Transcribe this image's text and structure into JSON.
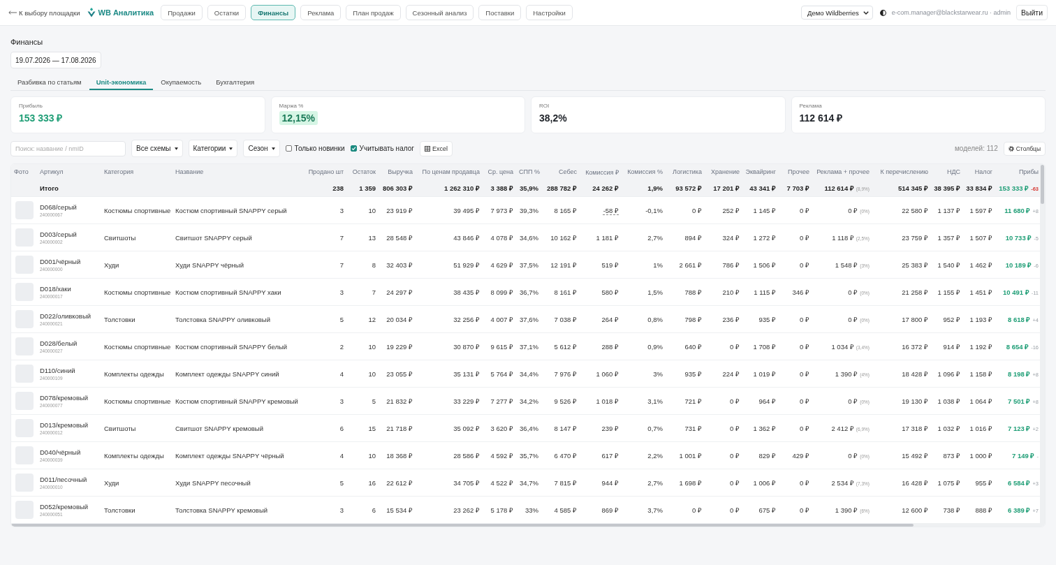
{
  "nav": {
    "back_link": "К выбору площадки",
    "brand": "WB Аналитика",
    "items": [
      {
        "label": "Продажи",
        "selected": false
      },
      {
        "label": "Остатки",
        "selected": false
      },
      {
        "label": "Финансы",
        "selected": true
      },
      {
        "label": "Реклама",
        "selected": false
      },
      {
        "label": "План продаж",
        "selected": false
      },
      {
        "label": "Сезонный анализ",
        "selected": false
      },
      {
        "label": "Поставки",
        "selected": false
      },
      {
        "label": "Настройки",
        "selected": false
      }
    ],
    "store_select": "Демо Wildberries",
    "user": "e-com.manager@blackstarwear.ru · admin",
    "logout": "Выйти"
  },
  "page": {
    "title": "Финансы",
    "date_range": "19.07.2026 — 17.08.2026",
    "tabs": [
      {
        "label": "Разбивка по статьям",
        "selected": false
      },
      {
        "label": "Unit-экономика",
        "selected": true
      },
      {
        "label": "Окупаемость",
        "selected": false
      },
      {
        "label": "Бухгалтерия",
        "selected": false
      }
    ]
  },
  "kpis": [
    {
      "label": "Прибыль",
      "value": "153 333 ₽",
      "kind": "accent"
    },
    {
      "label": "Маржа %",
      "value": "12,15%",
      "kind": "badge"
    },
    {
      "label": "ROI",
      "value": "38,2%",
      "kind": "plain"
    },
    {
      "label": "Реклама",
      "value": "112 614 ₽",
      "kind": "plain"
    }
  ],
  "filters": {
    "search": {
      "placeholder": "Поиск: название / nmID"
    },
    "dropdowns": [
      "Все схемы",
      "Категории",
      "Сезон"
    ],
    "checkboxes": [
      {
        "label": "Только новинки",
        "checked": false
      },
      {
        "label": "Учитывать налог",
        "checked": true
      }
    ],
    "export": "Excel",
    "count": "моделей: 112",
    "columns_button": "Столбцы"
  },
  "table": {
    "columns": [
      "Фото",
      "Артикул",
      "Категория",
      "Название",
      "Продано шт",
      "Остаток",
      "Выручка",
      "По ценам продавца",
      "Ср. цена",
      "СПП %",
      "Себес",
      "Комиссия ₽",
      "Комиссия %",
      "Логистика",
      "Хранение",
      "Эквайринг",
      "Прочее",
      "Реклама + прочее",
      "К перечислению",
      "НДС",
      "Налог",
      "Прибы"
    ],
    "total": {
      "cells": [
        "",
        "Итого",
        "",
        "",
        "238",
        "1 359",
        "806 303 ₽",
        "1 262 310 ₽",
        "3 388 ₽",
        "35,9%",
        "288 782 ₽",
        "24 262 ₽",
        "1,9%",
        "93 572 ₽",
        "17 201 ₽",
        "43 341 ₽",
        "7 703 ₽",
        {
          "kind": "share",
          "text": "112 614 ₽",
          "share": "(8,9%)"
        },
        "514 345 ₽",
        "38 395 ₽",
        "33 834 ₽",
        {
          "kind": "profit",
          "text": "153 333 ₽",
          "delta": "-63",
          "negative": true
        }
      ]
    },
    "rows": [
      {
        "cells": [
          {
            "kind": "photo"
          },
          {
            "kind": "article",
            "text": "D068/серый",
            "nmid": "240000067"
          },
          "Костюмы спортивные",
          "Костюм спортивный SNAPPY серый",
          "3",
          "10",
          "23 919 ₽",
          "39 495 ₽",
          "7 973 ₽",
          "39,3%",
          "8 165 ₽",
          {
            "kind": "flagged",
            "text": "-58 ₽"
          },
          "-0,1%",
          "0 ₽",
          "252 ₽",
          "1 145 ₽",
          "0 ₽",
          {
            "kind": "share",
            "text": "0 ₽",
            "share": "(0%)"
          },
          "22 580 ₽",
          "1 137 ₽",
          "1 597 ₽",
          {
            "kind": "profit",
            "text": "11 680 ₽",
            "delta": "+8",
            "negative": false
          }
        ]
      },
      {
        "cells": [
          {
            "kind": "photo"
          },
          {
            "kind": "article",
            "text": "D003/серый",
            "nmid": "240000002"
          },
          "Свитшоты",
          "Свитшот SNAPPY серый",
          "7",
          "13",
          "28 548 ₽",
          "43 846 ₽",
          "4 078 ₽",
          "34,6%",
          "10 162 ₽",
          "1 181 ₽",
          "2,7%",
          "894 ₽",
          "324 ₽",
          "1 272 ₽",
          "0 ₽",
          {
            "kind": "share",
            "text": "1 118 ₽",
            "share": "(2,5%)"
          },
          "23 759 ₽",
          "1 357 ₽",
          "1 507 ₽",
          {
            "kind": "profit",
            "text": "10 733 ₽",
            "delta": "-5",
            "negative": false
          }
        ]
      },
      {
        "cells": [
          {
            "kind": "photo"
          },
          {
            "kind": "article",
            "text": "D001/чёрный",
            "nmid": "240000000"
          },
          "Худи",
          "Худи SNAPPY чёрный",
          "7",
          "8",
          "32 403 ₽",
          "51 929 ₽",
          "4 629 ₽",
          "37,5%",
          "12 191 ₽",
          "519 ₽",
          "1%",
          "2 661 ₽",
          "786 ₽",
          "1 506 ₽",
          "0 ₽",
          {
            "kind": "share",
            "text": "1 548 ₽",
            "share": "(3%)"
          },
          "25 383 ₽",
          "1 540 ₽",
          "1 462 ₽",
          {
            "kind": "profit",
            "text": "10 189 ₽",
            "delta": "-6",
            "negative": false
          }
        ]
      },
      {
        "cells": [
          {
            "kind": "photo"
          },
          {
            "kind": "article",
            "text": "D018/хаки",
            "nmid": "240000017"
          },
          "Костюмы спортивные",
          "Костюм спортивный SNAPPY хаки",
          "3",
          "7",
          "24 297 ₽",
          "38 435 ₽",
          "8 099 ₽",
          "36,7%",
          "8 161 ₽",
          "580 ₽",
          "1,5%",
          "788 ₽",
          "210 ₽",
          "1 115 ₽",
          "346 ₽",
          {
            "kind": "share",
            "text": "0 ₽",
            "share": "(0%)"
          },
          "21 258 ₽",
          "1 155 ₽",
          "1 451 ₽",
          {
            "kind": "profit",
            "text": "10 491 ₽",
            "delta": "-11",
            "negative": false
          }
        ]
      },
      {
        "cells": [
          {
            "kind": "photo"
          },
          {
            "kind": "article",
            "text": "D022/оливковый",
            "nmid": "240000021"
          },
          "Толстовки",
          "Толстовка SNAPPY оливковый",
          "5",
          "12",
          "20 034 ₽",
          "32 256 ₽",
          "4 007 ₽",
          "37,6%",
          "7 038 ₽",
          "264 ₽",
          "0,8%",
          "798 ₽",
          "236 ₽",
          "935 ₽",
          "0 ₽",
          {
            "kind": "share",
            "text": "0 ₽",
            "share": "(0%)"
          },
          "17 800 ₽",
          "952 ₽",
          "1 193 ₽",
          {
            "kind": "profit",
            "text": "8 618 ₽",
            "delta": "+4",
            "negative": false
          }
        ]
      },
      {
        "cells": [
          {
            "kind": "photo"
          },
          {
            "kind": "article",
            "text": "D028/белый",
            "nmid": "240000027"
          },
          "Костюмы спортивные",
          "Костюм спортивный SNAPPY белый",
          "2",
          "10",
          "19 229 ₽",
          "30 870 ₽",
          "9 615 ₽",
          "37,1%",
          "5 612 ₽",
          "288 ₽",
          "0,9%",
          "640 ₽",
          "0 ₽",
          "1 708 ₽",
          "0 ₽",
          {
            "kind": "share",
            "text": "1 034 ₽",
            "share": "(3,4%)"
          },
          "16 372 ₽",
          "914 ₽",
          "1 192 ₽",
          {
            "kind": "profit",
            "text": "8 654 ₽",
            "delta": "-16",
            "negative": false
          }
        ]
      },
      {
        "cells": [
          {
            "kind": "photo"
          },
          {
            "kind": "article",
            "text": "D110/синий",
            "nmid": "240000109"
          },
          "Комплекты одежды",
          "Комплект одежды SNAPPY синий",
          "4",
          "10",
          "23 055 ₽",
          "35 131 ₽",
          "5 764 ₽",
          "34,4%",
          "7 976 ₽",
          "1 060 ₽",
          "3%",
          "935 ₽",
          "224 ₽",
          "1 019 ₽",
          "0 ₽",
          {
            "kind": "share",
            "text": "1 390 ₽",
            "share": "(4%)"
          },
          "18 428 ₽",
          "1 096 ₽",
          "1 158 ₽",
          {
            "kind": "profit",
            "text": "8 198 ₽",
            "delta": "+8",
            "negative": false
          }
        ]
      },
      {
        "cells": [
          {
            "kind": "photo"
          },
          {
            "kind": "article",
            "text": "D078/кремовый",
            "nmid": "240000077"
          },
          "Костюмы спортивные",
          "Костюм спортивный SNAPPY кремовый",
          "3",
          "5",
          "21 832 ₽",
          "33 229 ₽",
          "7 277 ₽",
          "34,2%",
          "9 526 ₽",
          "1 018 ₽",
          "3,1%",
          "721 ₽",
          "0 ₽",
          "964 ₽",
          "0 ₽",
          {
            "kind": "share",
            "text": "0 ₽",
            "share": "(0%)"
          },
          "19 130 ₽",
          "1 038 ₽",
          "1 064 ₽",
          {
            "kind": "profit",
            "text": "7 501 ₽",
            "delta": "+8",
            "negative": false
          }
        ]
      },
      {
        "cells": [
          {
            "kind": "photo"
          },
          {
            "kind": "article",
            "text": "D013/кремовый",
            "nmid": "240000012"
          },
          "Свитшоты",
          "Свитшот SNAPPY кремовый",
          "6",
          "15",
          "21 718 ₽",
          "35 092 ₽",
          "3 620 ₽",
          "36,4%",
          "8 147 ₽",
          "239 ₽",
          "0,7%",
          "731 ₽",
          "0 ₽",
          "1 362 ₽",
          "0 ₽",
          {
            "kind": "share",
            "text": "2 412 ₽",
            "share": "(6,9%)"
          },
          "17 318 ₽",
          "1 032 ₽",
          "1 016 ₽",
          {
            "kind": "profit",
            "text": "7 123 ₽",
            "delta": "+2",
            "negative": false
          }
        ]
      },
      {
        "cells": [
          {
            "kind": "photo"
          },
          {
            "kind": "article",
            "text": "D040/чёрный",
            "nmid": "240000039"
          },
          "Комплекты одежды",
          "Комплект одежды SNAPPY чёрный",
          "4",
          "10",
          "18 368 ₽",
          "28 586 ₽",
          "4 592 ₽",
          "35,7%",
          "6 470 ₽",
          "617 ₽",
          "2,2%",
          "1 001 ₽",
          "0 ₽",
          "829 ₽",
          "429 ₽",
          {
            "kind": "share",
            "text": "0 ₽",
            "share": "(0%)"
          },
          "15 492 ₽",
          "873 ₽",
          "1 000 ₽",
          {
            "kind": "profit",
            "text": "7 149 ₽",
            "delta": "-",
            "negative": false
          }
        ]
      },
      {
        "cells": [
          {
            "kind": "photo"
          },
          {
            "kind": "article",
            "text": "D011/песочный",
            "nmid": "240000010"
          },
          "Худи",
          "Худи SNAPPY песочный",
          "5",
          "16",
          "22 612 ₽",
          "34 705 ₽",
          "4 522 ₽",
          "34,7%",
          "7 815 ₽",
          "944 ₽",
          "2,7%",
          "1 698 ₽",
          "0 ₽",
          "1 006 ₽",
          "0 ₽",
          {
            "kind": "share",
            "text": "2 534 ₽",
            "share": "(7,3%)"
          },
          "16 428 ₽",
          "1 075 ₽",
          "955 ₽",
          {
            "kind": "profit",
            "text": "6 584 ₽",
            "delta": "+3",
            "negative": false
          }
        ]
      },
      {
        "cells": [
          {
            "kind": "photo"
          },
          {
            "kind": "article",
            "text": "D052/кремовый",
            "nmid": "240000051"
          },
          "Толстовки",
          "Толстовка SNAPPY кремовый",
          "3",
          "6",
          "15 534 ₽",
          "23 262 ₽",
          "5 178 ₽",
          "33%",
          "4 585 ₽",
          "869 ₽",
          "3,7%",
          "0 ₽",
          "0 ₽",
          "675 ₽",
          "0 ₽",
          {
            "kind": "share",
            "text": "1 390 ₽",
            "share": "(6%)"
          },
          "12 600 ₽",
          "738 ₽",
          "888 ₽",
          {
            "kind": "profit",
            "text": "6 389 ₽",
            "delta": "+7",
            "negative": false
          }
        ]
      }
    ]
  }
}
